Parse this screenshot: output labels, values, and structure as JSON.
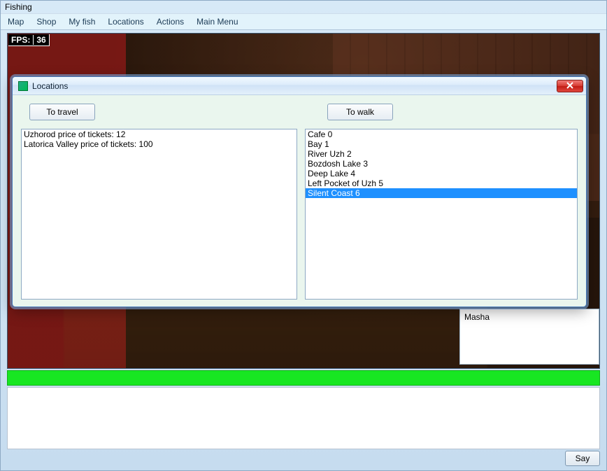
{
  "app_title": "Fishing",
  "menubar": [
    "Map",
    "Shop",
    "My fish",
    "Locations",
    "Actions",
    "Main Menu"
  ],
  "fps": {
    "label": "FPS:",
    "value": "36"
  },
  "people": [
    "Masha"
  ],
  "say_button": "Say",
  "modal": {
    "title": "Locations",
    "buttons": {
      "travel": "To travel",
      "walk": "To walk"
    },
    "travel_list": [
      "Uzhorod price of tickets: 12",
      "Latorica Valley price of tickets: 100"
    ],
    "walk_list": [
      {
        "label": "Cafe 0",
        "selected": false
      },
      {
        "label": "Bay 1",
        "selected": false
      },
      {
        "label": "River Uzh 2",
        "selected": false
      },
      {
        "label": "Bozdosh Lake 3",
        "selected": false
      },
      {
        "label": "Deep Lake 4",
        "selected": false
      },
      {
        "label": "Left Pocket of Uzh 5",
        "selected": false
      },
      {
        "label": "Silent Coast 6",
        "selected": true
      }
    ]
  }
}
